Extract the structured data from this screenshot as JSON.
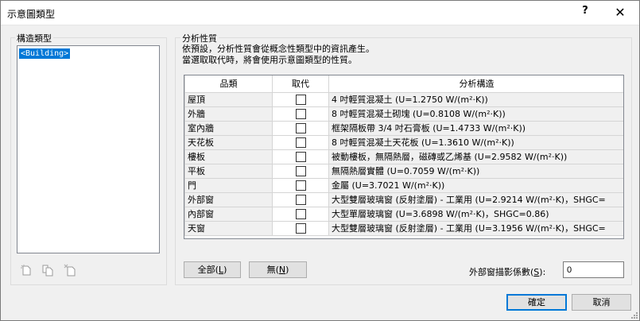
{
  "window": {
    "title": "示意圖類型",
    "help_label": "?",
    "close_label": "✕"
  },
  "left_panel": {
    "group_label": "構造類型",
    "items": [
      "<Building>"
    ],
    "icons": [
      "new-type-icon",
      "duplicate-type-icon",
      "delete-type-icon"
    ]
  },
  "right_panel": {
    "group_label": "分析性質",
    "description_line1": "依預設，分析性質會從概念性類型中的資訊產生。",
    "description_line2": "當選取取代時，將會使用示意圖類型的性質。"
  },
  "table": {
    "headers": {
      "category": "品類",
      "override": "取代",
      "analytic": "分析構造"
    },
    "rows": [
      {
        "category": "屋頂",
        "override": false,
        "analytic": "4 吋輕質混凝土 (U=1.2750 W/(m²·K))"
      },
      {
        "category": "外牆",
        "override": false,
        "analytic": "8 吋輕質混凝土砌塊 (U=0.8108 W/(m²·K))"
      },
      {
        "category": "室內牆",
        "override": false,
        "analytic": "框架隔板帶 3/4 吋石膏板 (U=1.4733 W/(m²·K))"
      },
      {
        "category": "天花板",
        "override": false,
        "analytic": "8 吋輕質混凝土天花板 (U=1.3610 W/(m²·K))"
      },
      {
        "category": "樓板",
        "override": false,
        "analytic": "被動樓板，無隔熱層，磁磚或乙烯基 (U=2.9582 W/(m²·K))"
      },
      {
        "category": "平板",
        "override": false,
        "analytic": "無隔熱層實體 (U=0.7059 W/(m²·K))"
      },
      {
        "category": "門",
        "override": false,
        "analytic": "金屬 (U=3.7021 W/(m²·K))"
      },
      {
        "category": "外部窗",
        "override": false,
        "analytic": "大型雙層玻璃窗 (反射塗層) - 工業用 (U=2.9214 W/(m²·K)，SHGC="
      },
      {
        "category": "內部窗",
        "override": false,
        "analytic": "大型單層玻璃窗 (U=3.6898 W/(m²·K)，SHGC=0.86)"
      },
      {
        "category": "天窗",
        "override": false,
        "analytic": "大型雙層玻璃窗 (反射塗層) - 工業用 (U=3.1956 W/(m²·K)，SHGC="
      }
    ]
  },
  "buttons": {
    "all_label": "全部(",
    "all_key": "L",
    "none_label": "無(",
    "none_key": "N",
    "ok_label": "確定",
    "cancel_label": "取消"
  },
  "shading": {
    "label_prefix": "外部窗描影係數(",
    "label_key": "S",
    "label_suffix": "):",
    "value": "0"
  },
  "colors": {
    "selection": "#0078d7",
    "default_button_border": "#0078d7"
  }
}
